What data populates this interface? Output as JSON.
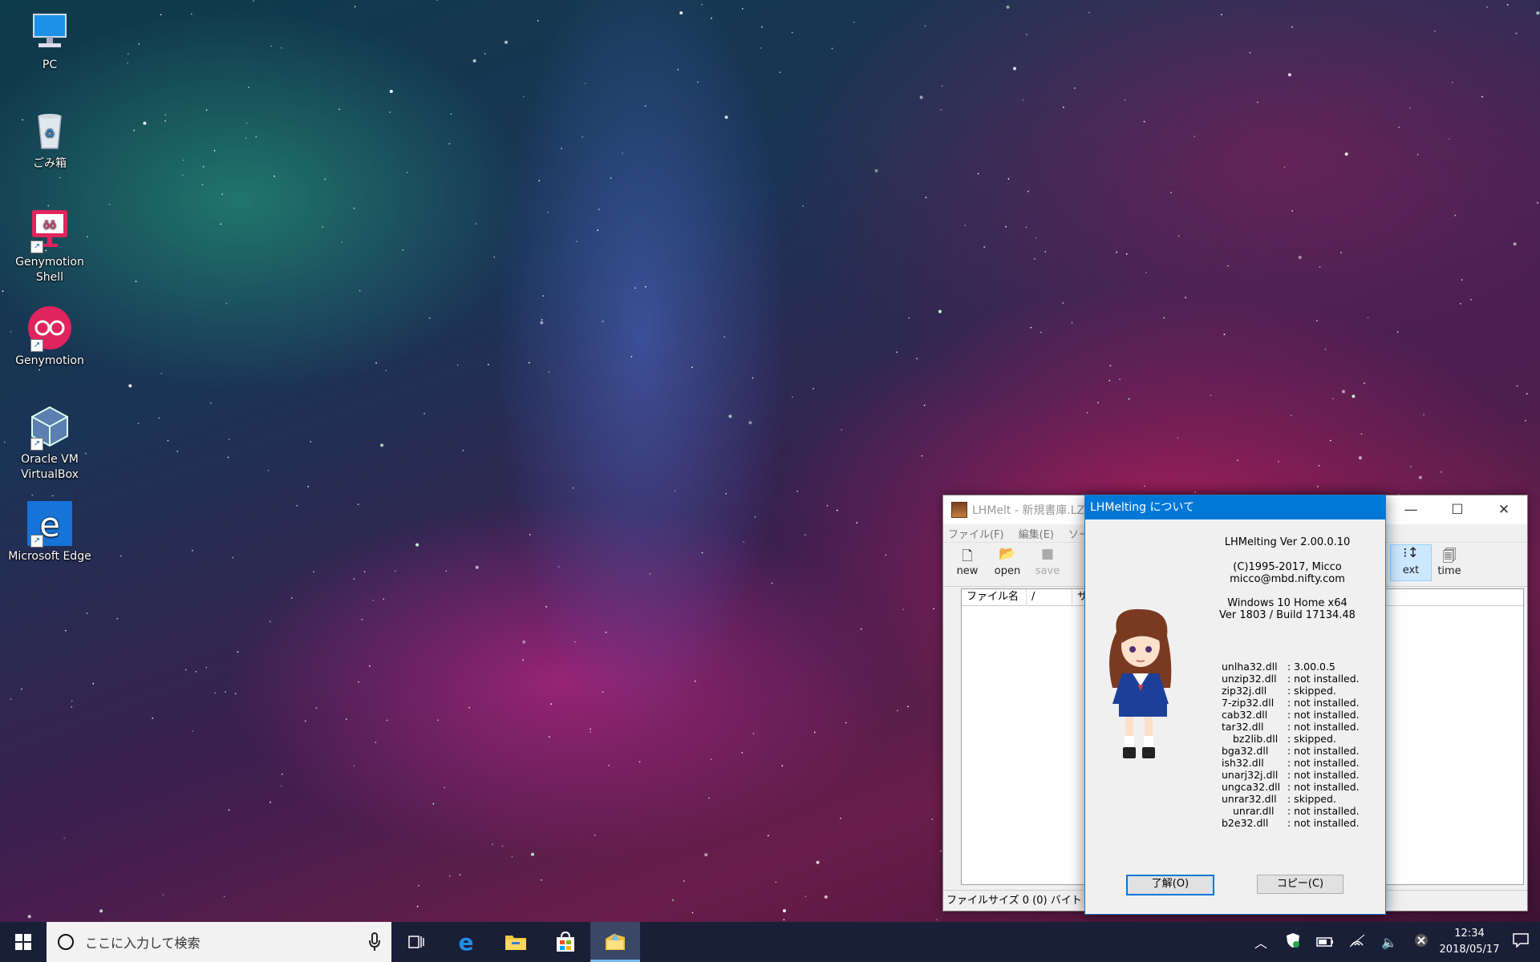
{
  "desktop": {
    "icons": [
      {
        "label": "PC"
      },
      {
        "label": "ごみ箱"
      },
      {
        "label": "Genymotion Shell"
      },
      {
        "label": "Genymotion"
      },
      {
        "label": "Oracle VM VirtualBox"
      },
      {
        "label": "Microsoft Edge"
      }
    ]
  },
  "main_window": {
    "title": "LHMelt - 新規書庫.LZ",
    "menu": [
      "ファイル(F)",
      "編集(E)",
      "ソー"
    ],
    "toolbar": [
      {
        "label": "new",
        "icon": "new-file-icon"
      },
      {
        "label": "open",
        "icon": "folder-open-icon"
      },
      {
        "label": "save",
        "icon": "save-icon"
      },
      {
        "label": "ext",
        "icon": "sort-ext-icon"
      },
      {
        "label": "time",
        "icon": "sort-time-icon"
      }
    ],
    "columns": [
      "ファイル名",
      "/",
      "サ"
    ],
    "status": "ファイルサイズ 0 (0) バイト"
  },
  "about_dialog": {
    "title": "LHMelting について",
    "version": "LHMelting Ver 2.00.0.10",
    "copyright": "(C)1995-2017, Micco",
    "email": "micco@mbd.nifty.com",
    "os": "Windows 10 Home  x64",
    "build": "Ver 1803 / Build 17134.48",
    "dlls": [
      {
        "name": "unlha32.dll",
        "status": ": 3.00.0.5"
      },
      {
        "name": "unzip32.dll",
        "status": ": not installed."
      },
      {
        "name": "zip32j.dll",
        "status": ": skipped."
      },
      {
        "name": "7-zip32.dll",
        "status": ": not installed."
      },
      {
        "name": "cab32.dll",
        "status": ": not installed."
      },
      {
        "name": "tar32.dll",
        "status": ": not installed."
      },
      {
        "name": "bz2lib.dll",
        "status": ": skipped.",
        "indent": true
      },
      {
        "name": "bga32.dll",
        "status": ": not installed."
      },
      {
        "name": "ish32.dll",
        "status": ": not installed."
      },
      {
        "name": "unarj32j.dll",
        "status": ": not installed."
      },
      {
        "name": "ungca32.dll",
        "status": ": not installed."
      },
      {
        "name": "unrar32.dll",
        "status": ": skipped."
      },
      {
        "name": "unrar.dll",
        "status": ": not installed.",
        "indent": true
      },
      {
        "name": "b2e32.dll",
        "status": ": not installed."
      }
    ],
    "ok_label": "了解(O)",
    "copy_label": "コピー(C)"
  },
  "taskbar": {
    "search_placeholder": "ここに入力して検索",
    "time": "12:34",
    "date": "2018/05/17"
  },
  "colors": {
    "taskbar": "#1a1f38",
    "accent": "#0078d7"
  }
}
